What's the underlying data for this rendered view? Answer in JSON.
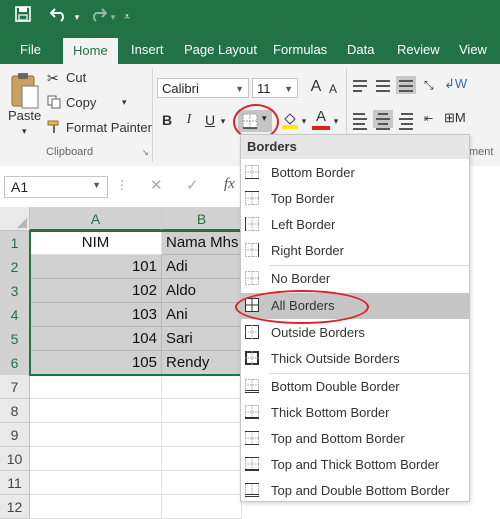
{
  "qat": {
    "save_icon": "save-icon",
    "undo_icon": "undo-icon",
    "redo_icon": "redo-icon",
    "customize_icon": "customize-icon"
  },
  "tabs": [
    "File",
    "Home",
    "Insert",
    "Page Layout",
    "Formulas",
    "Data",
    "Review",
    "View"
  ],
  "active_tab": "Home",
  "clipboard": {
    "paste_label": "Paste",
    "cut_label": "Cut",
    "copy_label": "Copy",
    "format_painter_label": "Format Painter",
    "group_label": "Clipboard"
  },
  "font": {
    "name": "Calibri",
    "size": "11",
    "bold": "B",
    "italic": "I",
    "underline": "U",
    "font_color_letter": "A"
  },
  "alignment_group_label_fragment": "ment",
  "name_box": "A1",
  "formula_fx": "fx",
  "columns": [
    "A",
    "B"
  ],
  "rows": [
    "1",
    "2",
    "3",
    "4",
    "5",
    "6",
    "7",
    "8",
    "9",
    "10",
    "11",
    "12"
  ],
  "table": {
    "headers": [
      "NIM",
      "Nama Mhs"
    ],
    "rows": [
      [
        "101",
        "Adi"
      ],
      [
        "102",
        "Aldo"
      ],
      [
        "103",
        "Ani"
      ],
      [
        "104",
        "Sari"
      ],
      [
        "105",
        "Rendy"
      ]
    ]
  },
  "borders_menu": {
    "title": "Borders",
    "items": [
      "Bottom Border",
      "Top Border",
      "Left Border",
      "Right Border",
      "No Border",
      "All Borders",
      "Outside Borders",
      "Thick Outside Borders",
      "Bottom Double Border",
      "Thick Bottom Border",
      "Top and Bottom Border",
      "Top and Thick Bottom Border",
      "Top and Double Bottom Border"
    ],
    "highlighted": "All Borders"
  },
  "colors": {
    "excel_green": "#217346",
    "highlight_red": "#d9252b",
    "selection_gray": "#d0d0d0"
  }
}
